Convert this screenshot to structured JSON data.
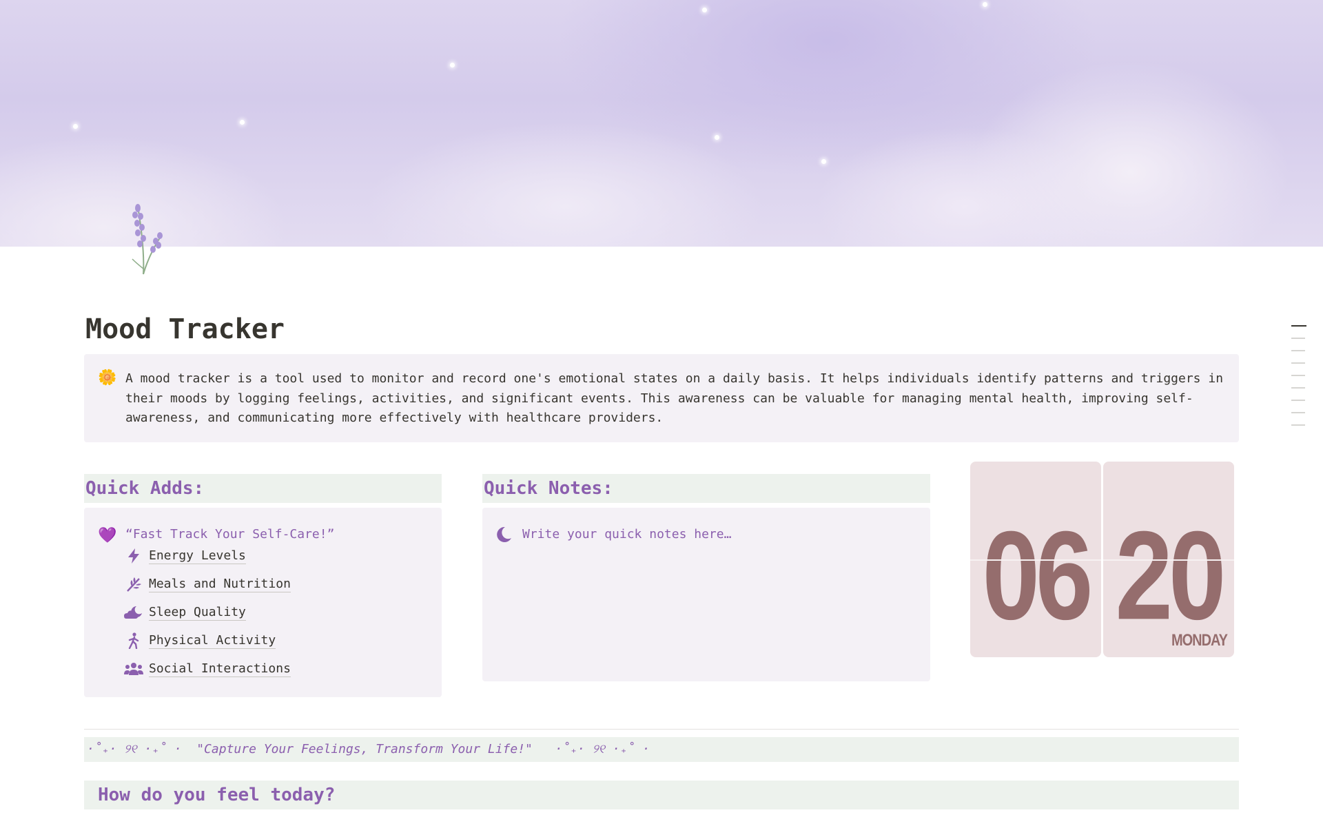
{
  "page": {
    "title": "Mood Tracker",
    "icon": "lavander-sprig-icon"
  },
  "callout": {
    "icon": "🌼",
    "text": "A mood tracker is a tool used to monitor and record one's emotional states on a daily basis. It helps individuals identify patterns and triggers in their moods by logging feelings, activities, and significant events. This awareness can be valuable for managing mental health, improving self-awareness, and communicating more effectively with healthcare providers."
  },
  "quick_adds": {
    "heading": "Quick Adds:",
    "icon": "💜",
    "quote": "“Fast Track Your Self-Care!”",
    "items": [
      {
        "label": "Energy Levels",
        "icon": "lightning-icon"
      },
      {
        "label": "Meals and Nutrition",
        "icon": "leaf-icon"
      },
      {
        "label": "Sleep Quality",
        "icon": "moon-cloud-icon"
      },
      {
        "label": "Physical Activity",
        "icon": "walking-person-icon"
      },
      {
        "label": "Social Interactions",
        "icon": "people-group-icon"
      }
    ]
  },
  "quick_notes": {
    "heading": "Quick Notes:",
    "placeholder": "Write your quick notes here…"
  },
  "clock": {
    "hour": "06",
    "minute": "20",
    "day": "MONDAY"
  },
  "banner": {
    "text": "·˚₊· ୨୧ ·₊˚ ·  \"Capture Your Feelings, Transform Your Life!\"   ·˚₊· ୨୧ ·₊˚ ·"
  },
  "feel": {
    "heading": "How do you feel today?"
  },
  "colors": {
    "accent": "#8b5fae",
    "section_bg": "#edf2ed",
    "panel_bg": "#f4f1f6",
    "clock_bg": "#ede0e2",
    "clock_text": "#956d6d"
  }
}
